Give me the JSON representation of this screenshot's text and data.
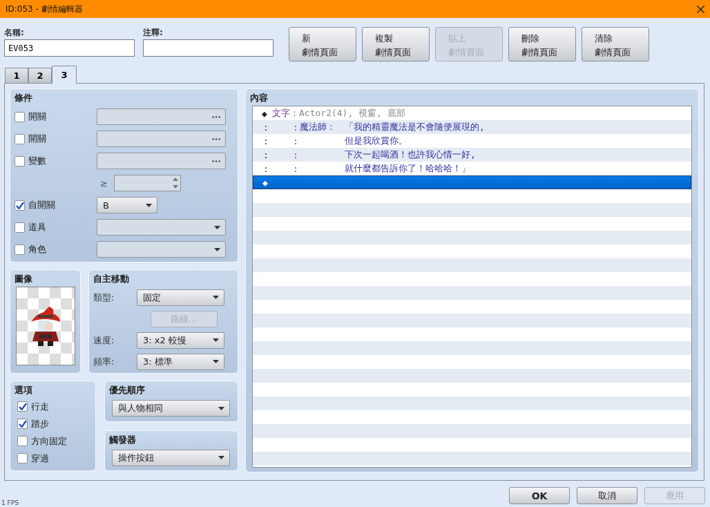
{
  "window": {
    "title": "ID:053 - 劇情編輯器"
  },
  "name_field": {
    "label": "名稱:",
    "value": "EV053"
  },
  "note_field": {
    "label": "注釋:"
  },
  "page_buttons": [
    {
      "line1": "新",
      "line2": "劇情頁面",
      "disabled": false
    },
    {
      "line1": "複製",
      "line2": "劇情頁面",
      "disabled": false
    },
    {
      "line1": "貼上",
      "line2": "劇情頁面",
      "disabled": true
    },
    {
      "line1": "刪除",
      "line2": "劇情頁面",
      "disabled": false
    },
    {
      "line1": "清除",
      "line2": "劇情頁面",
      "disabled": false
    }
  ],
  "tabs": [
    {
      "label": "1",
      "selected": false
    },
    {
      "label": "2",
      "selected": false
    },
    {
      "label": "3",
      "selected": true
    }
  ],
  "conditions": {
    "title": "條件",
    "items": [
      {
        "kind": "picker",
        "label": "開關",
        "checked": false
      },
      {
        "kind": "picker",
        "label": "開關",
        "checked": false
      },
      {
        "kind": "variable",
        "label": "變數",
        "checked": false,
        "compare": "≥"
      },
      {
        "kind": "short_select",
        "label": "自開關",
        "checked": true,
        "value": "B"
      },
      {
        "kind": "select",
        "label": "道具",
        "checked": false
      },
      {
        "kind": "select",
        "label": "角色",
        "checked": false
      }
    ]
  },
  "image": {
    "title": "圖像"
  },
  "autonomous": {
    "title": "自主移動",
    "rows": [
      {
        "kind": "select",
        "label": "類型:",
        "value": "固定"
      },
      {
        "kind": "button",
        "label": "路線...",
        "disabled": true
      },
      {
        "kind": "select",
        "label": "速度:",
        "value": "3: x2 較慢"
      },
      {
        "kind": "select",
        "label": "頻率:",
        "value": "3: 標準"
      }
    ]
  },
  "options": {
    "title": "選項",
    "items": [
      {
        "label": "行走",
        "checked": true
      },
      {
        "label": "踏步",
        "checked": true
      },
      {
        "label": "方向固定",
        "checked": false
      },
      {
        "label": "穿過",
        "checked": false
      }
    ]
  },
  "priority": {
    "title": "優先順序",
    "value": "與人物相同"
  },
  "trigger": {
    "title": "觸發器",
    "value": "操作按鈕"
  },
  "contents": {
    "title": "內容",
    "rows": [
      {
        "kind": "command",
        "marker": "◆",
        "command": "文字：",
        "params": "Actor2(4), 視窗, 底部",
        "selected": false
      },
      {
        "kind": "line",
        "mark1": ":",
        "mark2": ":",
        "speaker": "魔法師：",
        "text": "「我的精靈魔法是不會隨便展現的,",
        "selected": false
      },
      {
        "kind": "line",
        "mark1": ":",
        "mark2": ":",
        "text": "但是我欣賞你。",
        "selected": false
      },
      {
        "kind": "line",
        "mark1": ":",
        "mark2": ":",
        "text": "下次一起喝酒！也許我心情一好,",
        "selected": false
      },
      {
        "kind": "line",
        "mark1": ":",
        "mark2": ":",
        "text": "就什麼都告訴你了！哈哈哈！」",
        "selected": false
      },
      {
        "kind": "command",
        "marker": "◆",
        "selected": true
      }
    ]
  },
  "dialog_buttons": [
    {
      "label": "OK",
      "disabled": false,
      "bold": true
    },
    {
      "label": "取消",
      "disabled": false,
      "bold": false
    },
    {
      "label": "應用",
      "disabled": true,
      "bold": false
    }
  ],
  "status": "1 FPS"
}
